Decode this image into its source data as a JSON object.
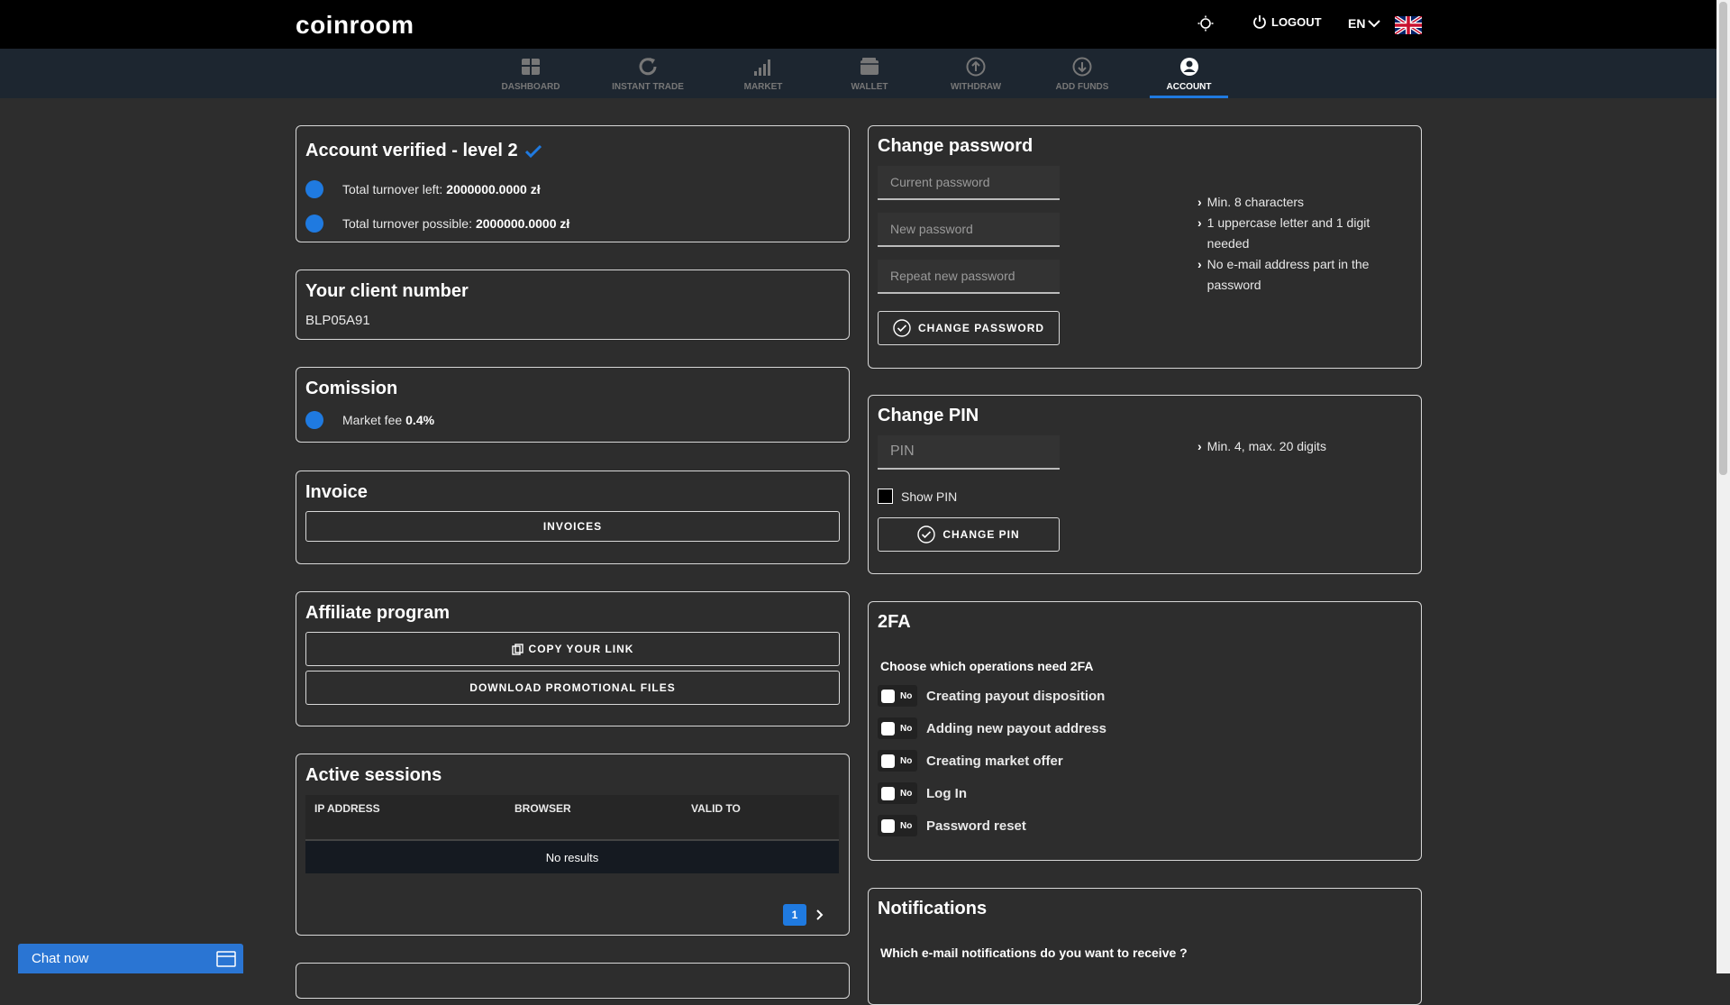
{
  "header": {
    "logo": "coinroom",
    "logout_label": "LOGOUT",
    "language": "EN"
  },
  "nav": {
    "items": [
      {
        "label": "DASHBOARD",
        "icon": "dashboard-icon"
      },
      {
        "label": "INSTANT TRADE",
        "icon": "refresh-icon"
      },
      {
        "label": "MARKET",
        "icon": "signal-bars-icon"
      },
      {
        "label": "WALLET",
        "icon": "wallet-icon"
      },
      {
        "label": "WITHDRAW",
        "icon": "arrow-up-circle-icon"
      },
      {
        "label": "ADD FUNDS",
        "icon": "arrow-down-circle-icon"
      },
      {
        "label": "ACCOUNT",
        "icon": "user-circle-icon"
      }
    ],
    "active": "ACCOUNT"
  },
  "verified": {
    "title": "Account verified - level 2",
    "turnover_left_label": "Total turnover left:",
    "turnover_left_value": "2000000.0000 zł",
    "turnover_possible_label": "Total turnover possible:",
    "turnover_possible_value": "2000000.0000 zł"
  },
  "client": {
    "title": "Your client number",
    "number": "BLP05A91"
  },
  "commission": {
    "title": "Comission",
    "fee_label": "Market fee",
    "fee_value": "0.4%"
  },
  "invoice": {
    "title": "Invoice",
    "button": "INVOICES"
  },
  "affiliate": {
    "title": "Affiliate program",
    "copy_button": "COPY YOUR LINK",
    "download_button": "DOWNLOAD PROMOTIONAL FILES"
  },
  "sessions": {
    "title": "Active sessions",
    "columns": [
      "IP ADDRESS",
      "BROWSER",
      "VALID TO"
    ],
    "empty": "No results",
    "page": "1"
  },
  "password": {
    "title": "Change password",
    "current_placeholder": "Current password",
    "new_placeholder": "New password",
    "repeat_placeholder": "Repeat new password",
    "button": "CHANGE PASSWORD",
    "hints": [
      "Min. 8 characters",
      "1 uppercase letter and 1 digit needed",
      "No e-mail address part in the password"
    ]
  },
  "pin": {
    "title": "Change PIN",
    "placeholder": "PIN",
    "show_label": "Show PIN",
    "button": "CHANGE PIN",
    "hint": "Min. 4, max. 20 digits"
  },
  "twofa": {
    "title": "2FA",
    "subtitle": "Choose which operations need 2FA",
    "toggle_label": "No",
    "operations": [
      "Creating payout disposition",
      "Adding new payout address",
      "Creating market offer",
      "Log In",
      "Password reset"
    ]
  },
  "notifications": {
    "title": "Notifications",
    "subtitle": "Which e-mail notifications do you want to receive ?"
  },
  "chat": {
    "label": "Chat now"
  },
  "colors": {
    "accent": "#1f7ae0",
    "background": "#2d2d2d",
    "topbar": "#000000",
    "navbar": "#1d2630"
  }
}
